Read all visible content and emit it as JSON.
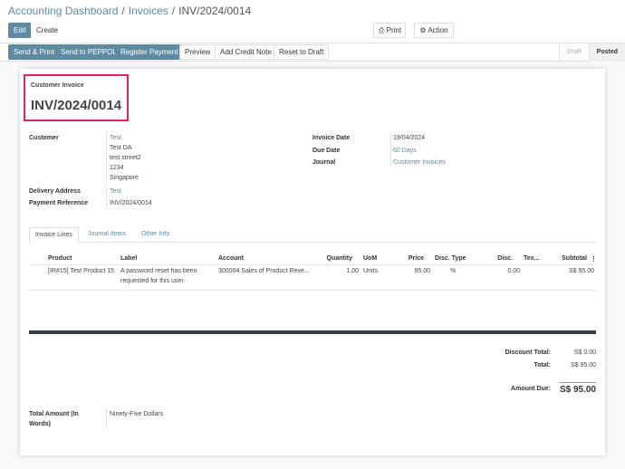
{
  "breadcrumb": {
    "items": [
      "Accounting Dashboard",
      "Invoices",
      "INV/2024/0014"
    ]
  },
  "toolbar": {
    "edit_label": "Edit",
    "create_label": "Create",
    "print_label": "Print",
    "action_label": "Action"
  },
  "statusbar": {
    "buttons": [
      "Send & Print",
      "Send to PEPPOL",
      "Register Payment",
      "Preview",
      "Add Credit Note",
      "Reset to Draft"
    ],
    "steps": [
      "Draft",
      "Posted"
    ],
    "active_step": "Posted"
  },
  "invoice": {
    "type_label": "Customer Invoice",
    "number": "INV/2024/0014",
    "customer_label": "Customer",
    "customer_name": "Test",
    "customer_address": [
      "Test DA",
      "test street2",
      "1234",
      "Singapore"
    ],
    "delivery_label": "Delivery Address",
    "delivery_value": "Test",
    "payment_ref_label": "Payment Reference",
    "payment_ref_value": "INV/2024/0014",
    "invoice_date_label": "Invoice Date",
    "invoice_date_value": "19/04/2024",
    "due_date_label": "Due Date",
    "due_date_value": "60 Days",
    "journal_label": "Journal",
    "journal_value": "Customer Invoices"
  },
  "tabs": [
    "Invoice Lines",
    "Journal Items",
    "Other Info"
  ],
  "lines": {
    "headers": [
      "Product",
      "Label",
      "Account",
      "Quantity",
      "UoM",
      "Price",
      "Disc. Type",
      "Disc.",
      "Tex...",
      "Subtotal"
    ],
    "rows": [
      {
        "product": "[IR#15] Test Product 15",
        "label_line1": "A password reset has been",
        "label_line2": "requested for this user.",
        "account": "300004 Sales of Product Reve...",
        "quantity": "1.00",
        "uom": "Units",
        "price": "95.00",
        "disc_type": "%",
        "disc": "0.00",
        "subtotal": "S$ 95.00"
      }
    ]
  },
  "totals": {
    "discount_label": "Discount Total:",
    "discount_value": "S$ 0.00",
    "total_label": "Total:",
    "total_value": "S$ 95.00",
    "amount_due_label": "Amount Due:",
    "amount_due_value": "S$ 95.00"
  },
  "amount_words": {
    "label_line1": "Total Amount (In",
    "label_line2": "Words)",
    "value": "Ninety-Five Dollars"
  }
}
